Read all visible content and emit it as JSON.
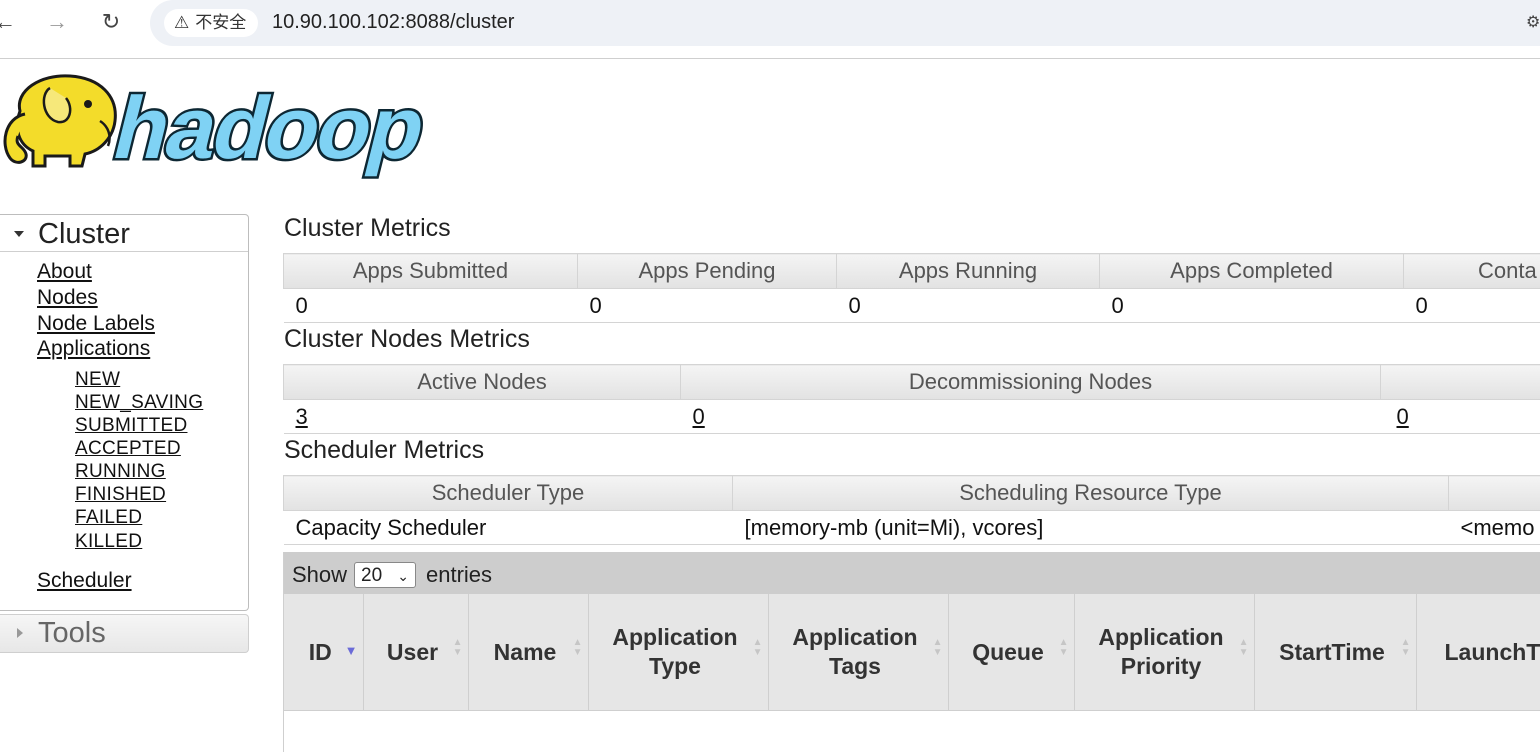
{
  "browser": {
    "back_icon": "arrow-left-icon",
    "forward_icon": "arrow-right-icon",
    "reload_icon": "reload-icon",
    "security_label": "不安全",
    "url": "10.90.100.102:8088/cluster"
  },
  "logo": {
    "text": "hadoop"
  },
  "sidebar": {
    "cluster_title": "Cluster",
    "links": [
      "About",
      "Nodes",
      "Node Labels",
      "Applications"
    ],
    "app_states": [
      "NEW",
      "NEW_SAVING",
      "SUBMITTED",
      "ACCEPTED",
      "RUNNING",
      "FINISHED",
      "FAILED",
      "KILLED"
    ],
    "scheduler_link": "Scheduler",
    "tools_title": "Tools"
  },
  "cluster_metrics": {
    "title": "Cluster Metrics",
    "headers": [
      "Apps Submitted",
      "Apps Pending",
      "Apps Running",
      "Apps Completed",
      "Conta"
    ],
    "values": [
      "0",
      "0",
      "0",
      "0",
      "0"
    ]
  },
  "nodes_metrics": {
    "title": "Cluster Nodes Metrics",
    "headers": [
      "Active Nodes",
      "Decommissioning Nodes",
      ""
    ],
    "values": [
      "3",
      "0",
      "0"
    ]
  },
  "scheduler_metrics": {
    "title": "Scheduler Metrics",
    "headers": [
      "Scheduler Type",
      "Scheduling Resource Type",
      ""
    ],
    "values": [
      "Capacity Scheduler",
      "[memory-mb (unit=Mi), vcores]",
      "<memo"
    ]
  },
  "apps_table": {
    "show_label": "Show",
    "entries_value": "20",
    "entries_label": "entries",
    "columns": [
      "ID",
      "User",
      "Name",
      "Application Type",
      "Application Tags",
      "Queue",
      "Application Priority",
      "StartTime",
      "LaunchTi"
    ]
  }
}
